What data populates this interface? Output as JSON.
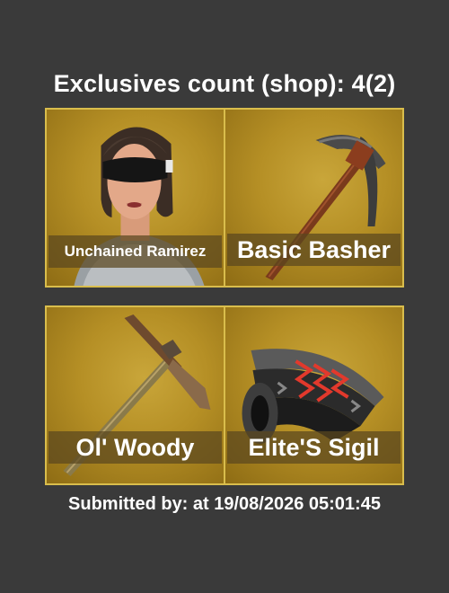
{
  "header": {
    "title": "Exclusives count (shop): 4(2)"
  },
  "items": [
    {
      "name": "Unchained Ramirez",
      "icon": "character-icon",
      "label_size": "small"
    },
    {
      "name": "Basic Basher",
      "icon": "pickaxe-icon",
      "label_size": "large"
    },
    {
      "name": "Ol' Woody",
      "icon": "pickaxe-icon",
      "label_size": "large"
    },
    {
      "name": "Elite'S Sigil",
      "icon": "wrap-icon",
      "label_size": "large"
    }
  ],
  "footer": {
    "text": "Submitted by:  at 19/08/2026 05:01:45"
  },
  "colors": {
    "background": "#3a3a3a",
    "tile_border": "#d9bd4c",
    "tile_gold": "#b58f25"
  }
}
